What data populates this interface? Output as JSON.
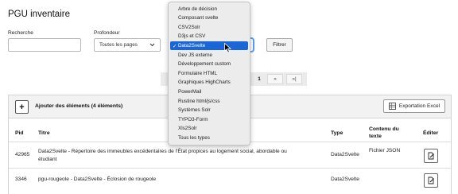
{
  "page": {
    "title": "PGU inventaire"
  },
  "filters": {
    "search_label": "Recherche",
    "search_value": "",
    "depth_label": "Profondeur",
    "depth_value": "Toutes les pages",
    "filter_button": "Filtrer"
  },
  "pagination": {
    "current": "1",
    "next": "»",
    "last": "»|"
  },
  "toolbar": {
    "add_icon": "+",
    "add_label": "Ajouter des éléments (4 éléments)",
    "export_label": "Exportation Excel"
  },
  "table": {
    "headers": {
      "pid": "Pid",
      "title": "Titre",
      "type": "Type",
      "content_line1": "Contenu du",
      "content_line2": "texte",
      "edit": "Éditer"
    },
    "rows": [
      {
        "pid": "42965",
        "title_line1": "Data2Svelte - Répertoire des immeubles excédentaires de l'État propices au logement social, abordable ou",
        "title_line2": "étudiant",
        "type": "Data2Svelte",
        "content": "Fichier JSON"
      },
      {
        "pid": "3346",
        "title_line1": "pgu-rougeole - Data2Svelte - Éclosion de rougeole",
        "title_line2": "",
        "type": "Data2Svelte",
        "content": ""
      }
    ]
  },
  "type_dropdown": {
    "selected": "Data2Svelte",
    "check": "✓",
    "options": [
      "Arbre de décision",
      "Composant svelte",
      "CSV2Solr",
      "D3js et CSV",
      "Data2Svelte",
      "Dev JS externe",
      "Développement custom",
      "Formulaire HTML",
      "Graphiques HighCharts",
      "PowerMail",
      "Rustine html/js/css",
      "Systèmes Solr",
      "TYPO3-Form",
      "Xls2Solr",
      "Tous les types"
    ]
  },
  "icons": {
    "edit": "edit-icon",
    "export": "spreadsheet-icon",
    "cursor": "mouse-pointer-icon",
    "chevron": "chevron-down-icon"
  },
  "colors": {
    "selection": "#1a66d6",
    "focus_ring": "#5b9df5"
  }
}
